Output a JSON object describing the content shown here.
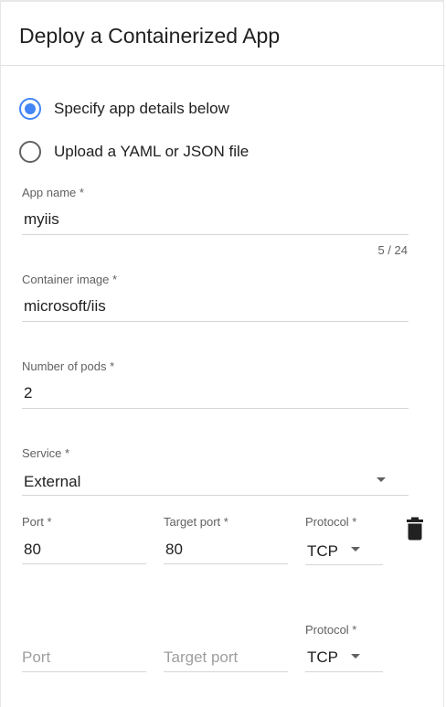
{
  "header": {
    "title": "Deploy a Containerized App"
  },
  "source_options": [
    {
      "label": "Specify app details below",
      "selected": true
    },
    {
      "label": "Upload a YAML or JSON file",
      "selected": false
    }
  ],
  "form": {
    "app_name": {
      "label": "App name *",
      "value": "myiis",
      "counter": "5 / 24"
    },
    "container_image": {
      "label": "Container image *",
      "value": "microsoft/iis"
    },
    "pods": {
      "label": "Number of pods *",
      "value": "2"
    },
    "service": {
      "label": "Service *",
      "value": "External"
    }
  },
  "port_mappings": [
    {
      "port_label": "Port *",
      "port_value": "80",
      "target_label": "Target port *",
      "target_value": "80",
      "protocol_label": "Protocol *",
      "protocol_value": "TCP"
    },
    {
      "port_placeholder": "Port",
      "target_placeholder": "Target port",
      "protocol_label": "Protocol *",
      "protocol_value": "TCP"
    }
  ],
  "icons": {
    "delete": "trash-icon",
    "dropdown": "chevron-down-icon"
  },
  "colors": {
    "accent": "#4285f4",
    "text": "#212121",
    "secondary_text": "#616161",
    "placeholder": "#9e9e9e",
    "divider": "#d6d6d6"
  }
}
